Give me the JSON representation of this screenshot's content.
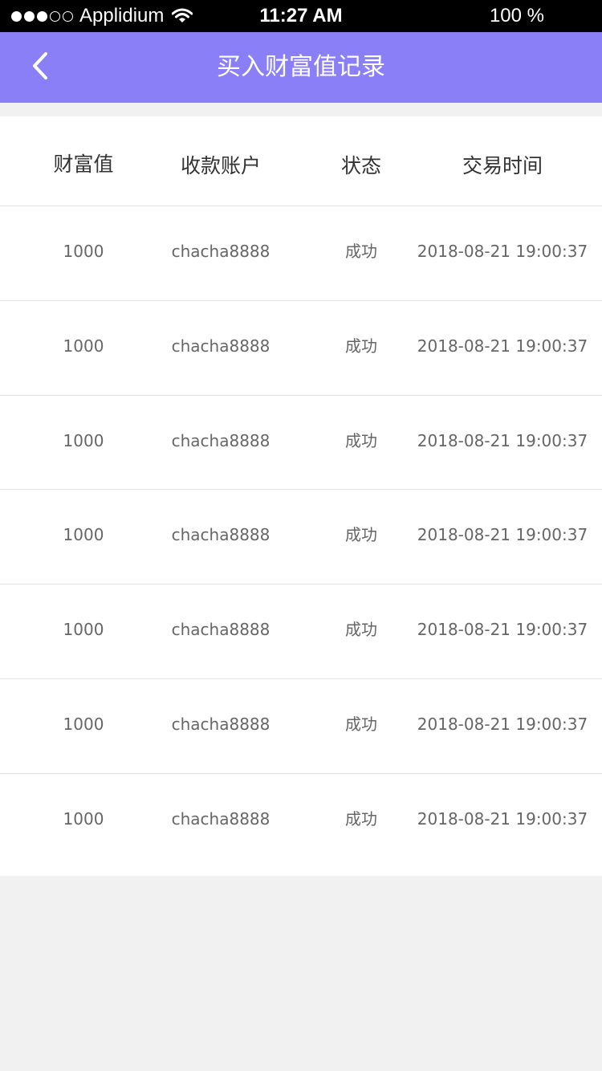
{
  "status_bar": {
    "carrier": "Applidium",
    "time": "11:27 AM",
    "battery": "100 %"
  },
  "nav": {
    "title": "买入财富值记录",
    "back_icon": "chevron-left-icon"
  },
  "table": {
    "headers": [
      "财富值",
      "收款账户",
      "状态",
      "交易时间"
    ],
    "rows": [
      [
        "1000",
        "chacha8888",
        "成功",
        "2018-08-21 19:00:37"
      ],
      [
        "1000",
        "chacha8888",
        "成功",
        "2018-08-21 19:00:37"
      ],
      [
        "1000",
        "chacha8888",
        "成功",
        "2018-08-21 19:00:37"
      ],
      [
        "1000",
        "chacha8888",
        "成功",
        "2018-08-21 19:00:37"
      ],
      [
        "1000",
        "chacha8888",
        "成功",
        "2018-08-21 19:00:37"
      ],
      [
        "1000",
        "chacha8888",
        "成功",
        "2018-08-21 19:00:37"
      ],
      [
        "1000",
        "chacha8888",
        "成功",
        "2018-08-21 19:00:37"
      ]
    ]
  },
  "colors": {
    "nav_background": "#8b7ff8",
    "page_background": "#f1f1f1"
  }
}
